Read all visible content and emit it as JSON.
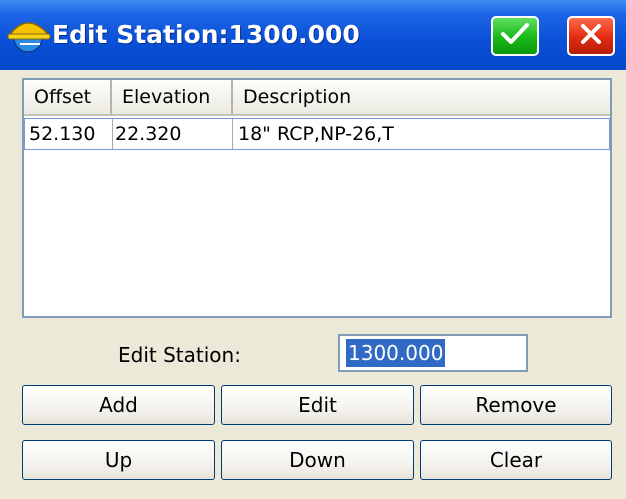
{
  "window": {
    "title": "Edit Station:1300.000"
  },
  "list": {
    "columns": [
      "Offset",
      "Elevation",
      "Description"
    ],
    "rows": [
      {
        "offset": "52.130",
        "elevation": "22.320",
        "description": "18\" RCP,NP-26,T"
      }
    ]
  },
  "edit_station": {
    "label": "Edit Station:",
    "value": "1300.000"
  },
  "buttons": {
    "add": "Add",
    "edit": "Edit",
    "remove": "Remove",
    "up": "Up",
    "down": "Down",
    "clear": "Clear"
  },
  "icons": {
    "app": "hardhat-globe-icon",
    "ok": "check-icon",
    "close": "close-icon"
  },
  "colors": {
    "titlebar": "#0a51d8",
    "ok_button": "#18b818",
    "close_button": "#e12a10",
    "selection": "#316ac5"
  }
}
